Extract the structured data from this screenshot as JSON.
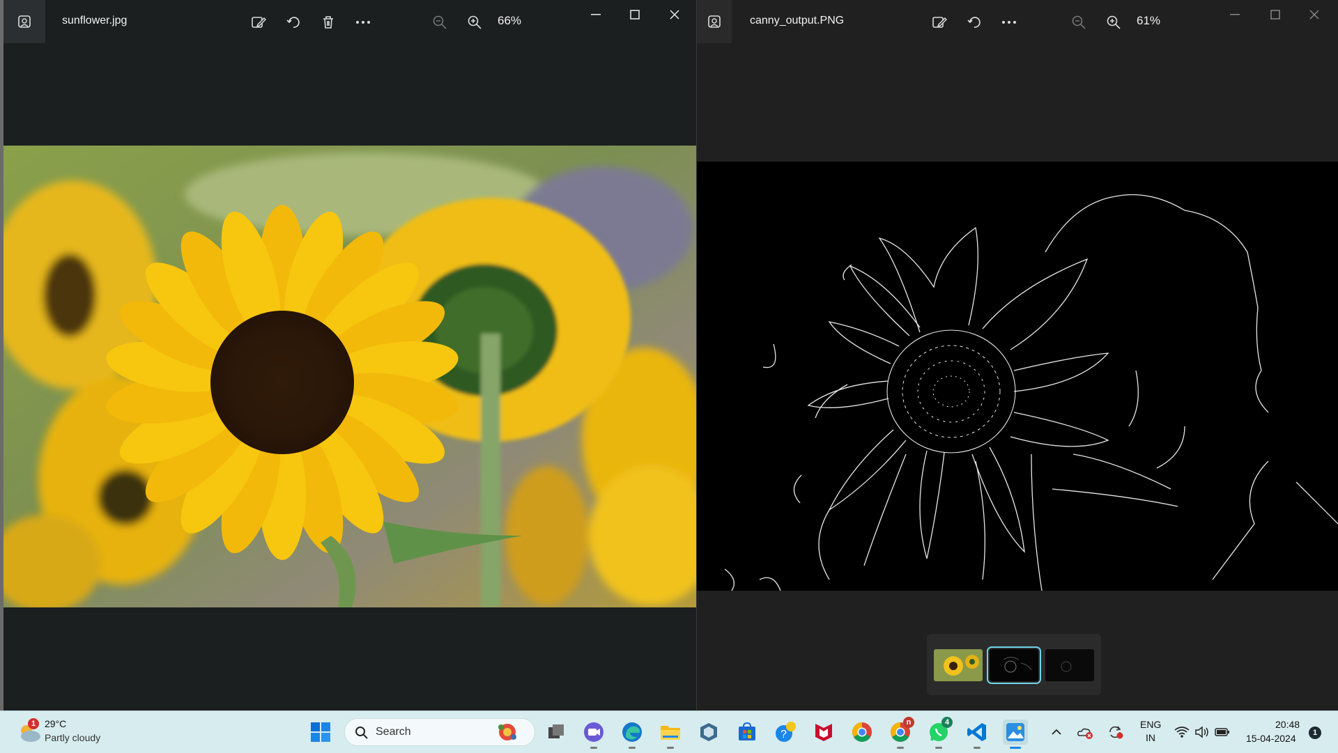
{
  "left_window": {
    "file_name": "sunflower.jpg",
    "zoom": "66%",
    "toolbar": [
      "edit-image",
      "rotate",
      "delete",
      "more"
    ]
  },
  "right_window": {
    "file_name": "canny_output.PNG",
    "zoom": "61%",
    "toolbar": [
      "edit-image",
      "rotate",
      "more"
    ],
    "filmstrip_selected_index": 1
  },
  "taskbar": {
    "weather": {
      "temp": "29°C",
      "condition": "Partly cloudy",
      "badge": "1"
    },
    "search_placeholder": "Search",
    "apps": [
      "start",
      "search",
      "task-view",
      "zoom",
      "edge",
      "file-explorer",
      "vpn",
      "microsoft-store",
      "quick-assist",
      "mcafee",
      "chrome",
      "chrome-profile",
      "whatsapp",
      "vscode",
      "photos"
    ],
    "chrome_badge": "n",
    "whatsapp_badge": "4",
    "language": {
      "line1": "ENG",
      "line2": "IN"
    },
    "time": "20:48",
    "date": "15-04-2024",
    "notification_count": "1"
  }
}
